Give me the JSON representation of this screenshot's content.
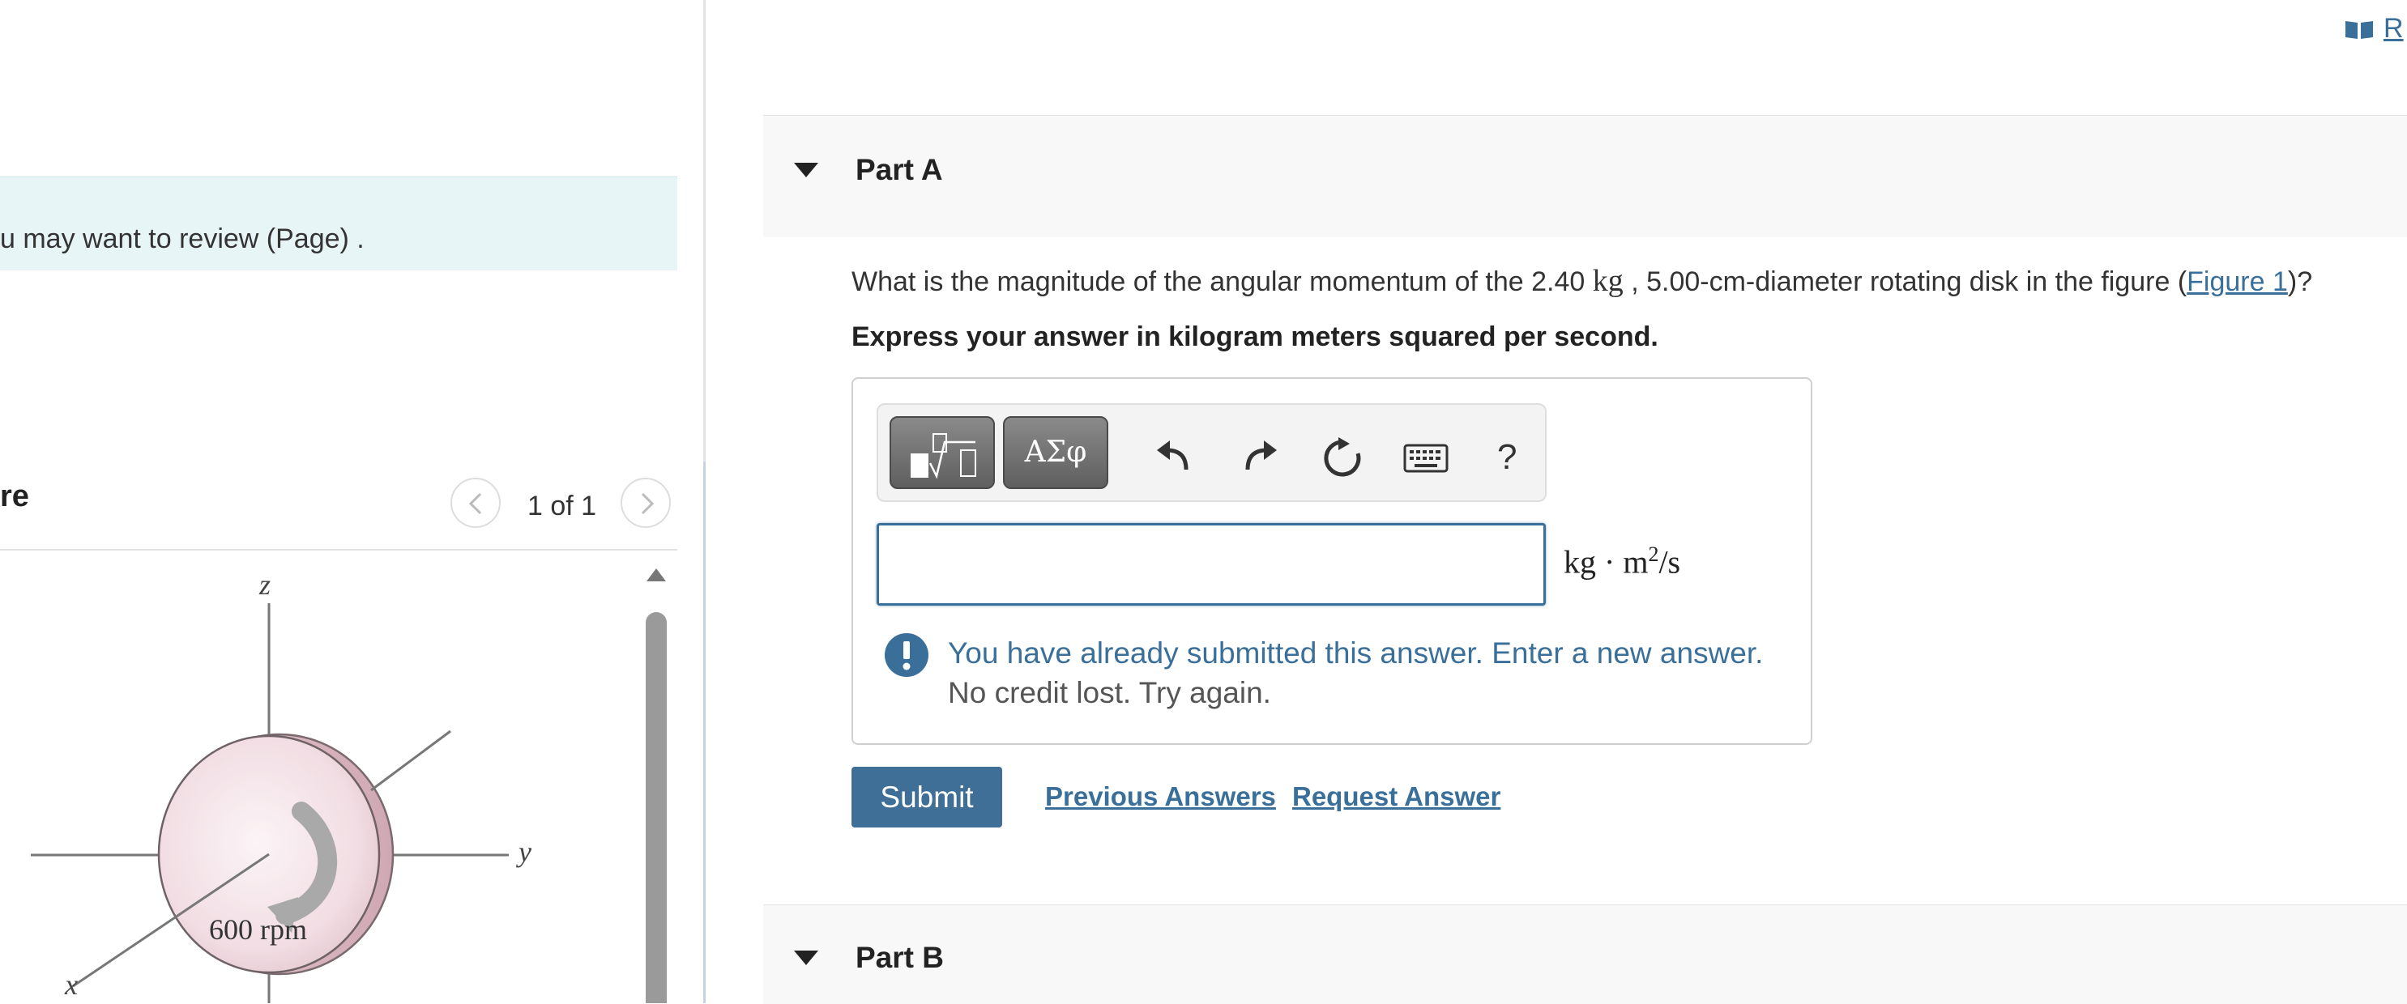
{
  "left_panel": {
    "review_text": "u may want to review (Page) .",
    "figure_title": "re",
    "pager_count": "1 of 1",
    "figure": {
      "axis_z": "z",
      "axis_y": "y",
      "axis_x": "x",
      "speed_label": "600 rpm"
    }
  },
  "header": {
    "resource_label": "R"
  },
  "part_a": {
    "title": "Part A",
    "question_prefix": "What is the magnitude of the angular momentum of the 2.40 ",
    "question_unit": "kg",
    "question_middle": " , 5.00-cm-diameter rotating disk in the figure (",
    "figure_link": "Figure 1",
    "question_suffix": ")?",
    "instruction": "Express your answer in kilogram meters squared per second.",
    "toolbar": {
      "greek_label": "ΑΣφ",
      "help_label": "?"
    },
    "input_value": "",
    "unit_prefix": "kg · m",
    "unit_exp": "2",
    "unit_suffix": "/s",
    "alert_line1": "You have already submitted this answer. Enter a new answer.",
    "alert_line2": "No credit lost. Try again.",
    "submit_label": "Submit",
    "previous_answers_label": "Previous Answers",
    "request_answer_label": "Request Answer"
  },
  "part_b": {
    "title": "Part B"
  },
  "colors": {
    "accent": "#3a6f9a",
    "submit_bg": "#3f6f96",
    "banner_bg": "#e8f5f6"
  }
}
